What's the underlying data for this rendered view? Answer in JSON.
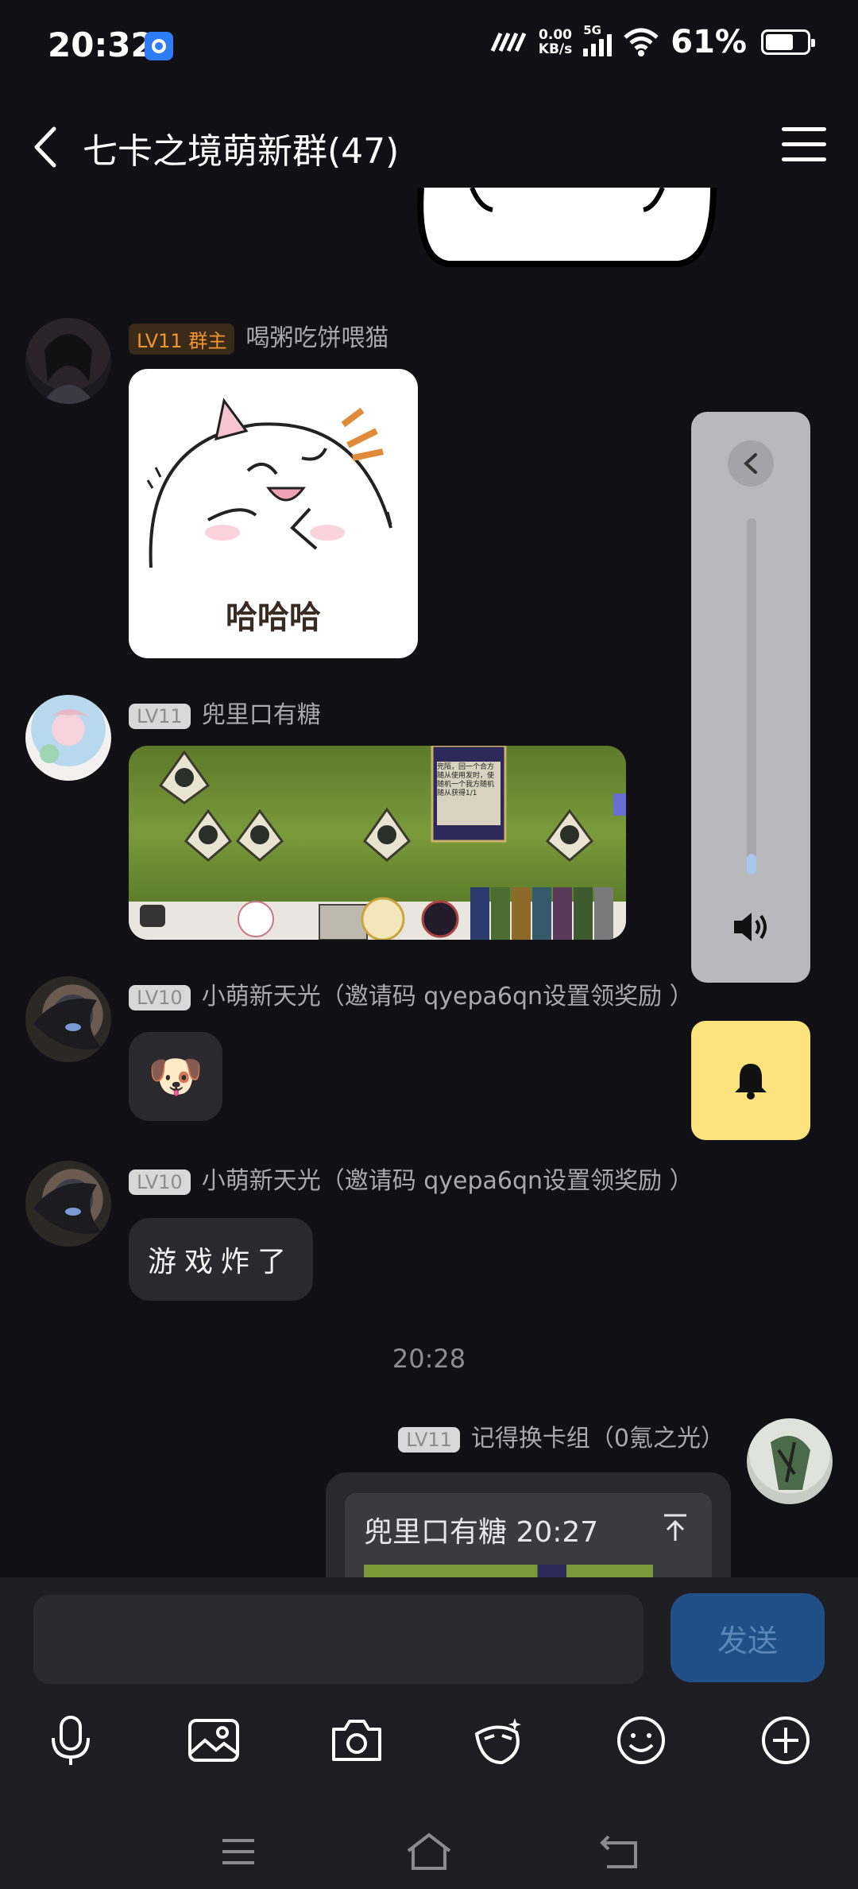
{
  "status_bar": {
    "time": "20:32",
    "net_speed_value": "0.00",
    "net_speed_unit": "KB/s",
    "network_type": "5G",
    "battery": "61%"
  },
  "header": {
    "title": "七卡之境萌新群(47)"
  },
  "messages": [
    {
      "badge": "LV11 群主",
      "name": "喝粥吃饼喂猫",
      "sticker_text": "哈哈哈"
    },
    {
      "badge": "LV11",
      "name": "兜里口有糖"
    },
    {
      "badge": "LV10",
      "name": "小萌新天光（邀请码 qyepa6qn设置领奖励 ）",
      "emoji": "🐶"
    },
    {
      "badge": "LV10",
      "name": "小萌新天光（邀请码 qyepa6qn设置领奖励 ）",
      "text": "游戏炸了"
    }
  ],
  "timestamp": "20:28",
  "my_message": {
    "badge": "LV11",
    "name": "记得换卡组（0氪之光）",
    "quote": "兜里口有糖 20:27"
  },
  "game_screenshot": {
    "card_desc": "兜陌，回一个合方\n随从使用发时，使\n随机一个我方随机\n随从获得1/1"
  },
  "input": {
    "placeholder": "",
    "send_label": "发送"
  },
  "icons": {
    "toolbar": [
      "microphone-icon",
      "image-icon",
      "camera-icon",
      "sticker-icon",
      "emoji-icon",
      "plus-icon"
    ],
    "nav": [
      "menu-nav-icon",
      "home-nav-icon",
      "back-nav-icon"
    ]
  },
  "colors": {
    "background": "#111115",
    "bubble": "#2a2a2e",
    "owner_badge": "#f2952f",
    "send_button": "#1f4f86",
    "bell_button": "#fbe27c",
    "volume_panel": "#b9b9bd"
  }
}
